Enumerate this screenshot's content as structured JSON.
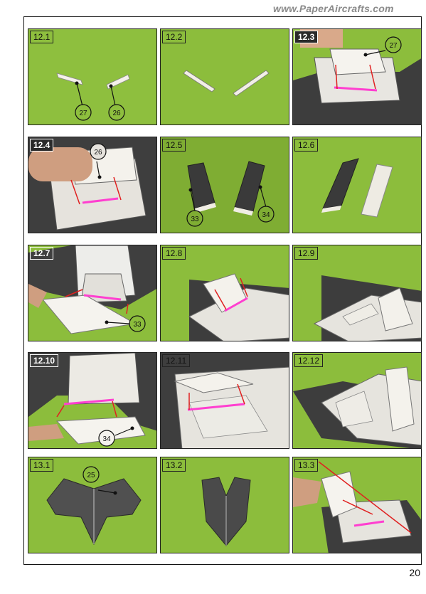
{
  "header": {
    "site_url": "www.PaperAircrafts.com"
  },
  "page_number": "20",
  "panels": [
    {
      "label": "12.1",
      "callouts": [
        "27",
        "26"
      ]
    },
    {
      "label": "12.2",
      "callouts": []
    },
    {
      "label": "12.3",
      "callouts": [
        "27"
      ]
    },
    {
      "label": "12.4",
      "callouts": [
        "26"
      ]
    },
    {
      "label": "12.5",
      "callouts": [
        "33",
        "34"
      ]
    },
    {
      "label": "12.6",
      "callouts": []
    },
    {
      "label": "12.7",
      "callouts": [
        "33"
      ]
    },
    {
      "label": "12.8",
      "callouts": []
    },
    {
      "label": "12.9",
      "callouts": []
    },
    {
      "label": "12.10",
      "callouts": [
        "34"
      ]
    },
    {
      "label": "12.11",
      "callouts": []
    },
    {
      "label": "12.12",
      "callouts": []
    },
    {
      "label": "13.1",
      "callouts": [
        "25"
      ]
    },
    {
      "label": "13.2",
      "callouts": []
    },
    {
      "label": "13.3",
      "callouts": []
    }
  ],
  "colors": {
    "background_green": "#8fc03d",
    "arrow_red": "#e02020",
    "glue_magenta": "#ff3fd0",
    "part_gray": "#4a4a4a"
  }
}
